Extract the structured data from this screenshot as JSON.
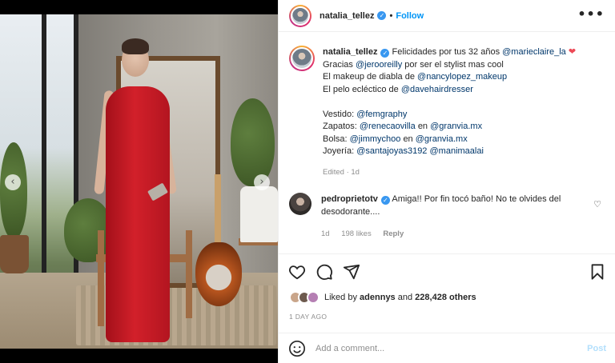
{
  "post": {
    "username": "natalia_tellez",
    "follow_label": "Follow",
    "dot": "•",
    "more_label": "•••"
  },
  "caption": {
    "username": "natalia_tellez",
    "line1_text": "Felicidades por tus 32 años",
    "line1_mention": "@marieclaire_la",
    "line2_pre": "Gracias",
    "line2_mention": "@jerooreilly",
    "line2_post": "por ser el stylist mas cool",
    "line3_pre": "El makeup de diabla de",
    "line3_mention": "@nancylopez_makeup",
    "line4_pre": "El pelo ecléctico de",
    "line4_mention": "@davehairdresser",
    "vestido_label": "Vestido:",
    "vestido_mention": "@femgraphy",
    "zapatos_label": "Zapatos:",
    "zapatos_mention1": "@renecaovilla",
    "zapatos_en": "en",
    "zapatos_mention2": "@granvia.mx",
    "bolsa_label": "Bolsa:",
    "bolsa_mention1": "@jimmychoo",
    "bolsa_en": "en",
    "bolsa_mention2": "@granvia.mx",
    "joyeria_label": "Joyería:",
    "joyeria_mention1": "@santajoyas3192",
    "joyeria_mention2": "@manimaalai",
    "edited": "Edited · 1d"
  },
  "comment": {
    "username": "pedroprietotv",
    "text": "Amiga!! Por fin tocó baño! No te olvides del desodorante....",
    "age": "1d",
    "likes": "198 likes",
    "reply_label": "Reply"
  },
  "likes": {
    "prefix": "Liked by",
    "user": "adennys",
    "and": "and",
    "others": "228,428 others"
  },
  "time_ago": "1 DAY AGO",
  "add_comment": {
    "placeholder": "Add a comment...",
    "post_label": "Post"
  },
  "colors": {
    "link": "#0095f6",
    "mention": "#00376b",
    "muted": "#8e8e8e",
    "heart": "#ed4956"
  },
  "icons": [
    "verified-icon",
    "more-icon",
    "heart-icon",
    "comment-icon",
    "share-icon",
    "save-icon",
    "emoji-icon",
    "chevron-left-icon",
    "chevron-right-icon"
  ]
}
